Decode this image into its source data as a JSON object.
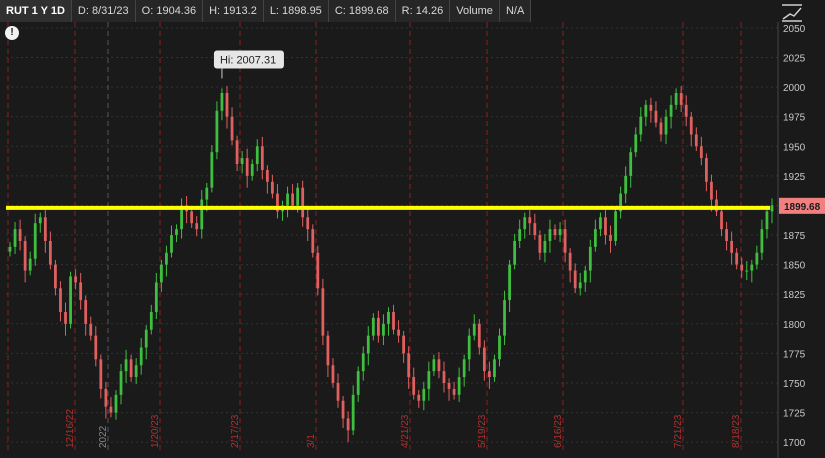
{
  "header": {
    "symbol": "RUT 1 Y 1D",
    "date": "D: 8/31/23",
    "open": "O: 1904.36",
    "high": "H: 1913.2",
    "low": "L: 1898.95",
    "close": "C: 1899.68",
    "range": "R: 14.26",
    "volume_label": "Volume",
    "volume_value": "N/A"
  },
  "alert_icon_glyph": "!",
  "price_tag": "1899.68",
  "hi_label": "Hi: 2007.31",
  "colors": {
    "background": "#1a1a1a",
    "up": "#3fbf3f",
    "down": "#e06060",
    "support_line": "#ffff00",
    "month_line": "#8b2020",
    "price_tag_bg": "#f08080"
  },
  "chart_data": {
    "type": "candlestick",
    "title": "RUT 1 Y 1D",
    "ylim": [
      1690,
      2055
    ],
    "y_ticks": [
      2050,
      2025,
      2000,
      1975,
      1950,
      1925,
      1900,
      1875,
      1850,
      1825,
      1800,
      1775,
      1750,
      1725,
      1700
    ],
    "x_tick_labels": [
      "12/16/22",
      "2022",
      "1/20/23",
      "2/17/23",
      "3/1",
      "4/21/23",
      "5/19/23",
      "6/16/23",
      "7/21/23",
      "8/18/23"
    ],
    "horizontal_line_value": 1898,
    "last_price": 1899.68,
    "high_marker": {
      "label": "Hi: 2007.31",
      "value": 2007.31
    },
    "closes": [
      1865,
      1880,
      1870,
      1845,
      1855,
      1885,
      1890,
      1870,
      1850,
      1830,
      1810,
      1800,
      1840,
      1835,
      1820,
      1800,
      1790,
      1770,
      1745,
      1730,
      1725,
      1740,
      1760,
      1770,
      1755,
      1765,
      1780,
      1795,
      1810,
      1835,
      1850,
      1860,
      1875,
      1880,
      1900,
      1895,
      1885,
      1880,
      1905,
      1915,
      1945,
      1980,
      1995,
      1975,
      1955,
      1935,
      1940,
      1925,
      1935,
      1950,
      1930,
      1920,
      1910,
      1895,
      1900,
      1910,
      1900,
      1915,
      1890,
      1880,
      1860,
      1830,
      1790,
      1765,
      1750,
      1735,
      1720,
      1710,
      1740,
      1760,
      1775,
      1790,
      1805,
      1790,
      1800,
      1810,
      1795,
      1790,
      1775,
      1755,
      1740,
      1735,
      1745,
      1760,
      1770,
      1760,
      1750,
      1745,
      1740,
      1755,
      1770,
      1790,
      1800,
      1780,
      1760,
      1755,
      1770,
      1790,
      1820,
      1850,
      1870,
      1880,
      1890,
      1885,
      1875,
      1860,
      1870,
      1880,
      1875,
      1880,
      1860,
      1845,
      1830,
      1835,
      1845,
      1865,
      1880,
      1890,
      1875,
      1870,
      1895,
      1910,
      1925,
      1945,
      1960,
      1975,
      1985,
      1980,
      1970,
      1960,
      1975,
      1985,
      1995,
      1985,
      1975,
      1960,
      1950,
      1940,
      1920,
      1905,
      1895,
      1880,
      1870,
      1860,
      1850,
      1845,
      1845,
      1850,
      1860,
      1880,
      1895,
      1900
    ]
  }
}
